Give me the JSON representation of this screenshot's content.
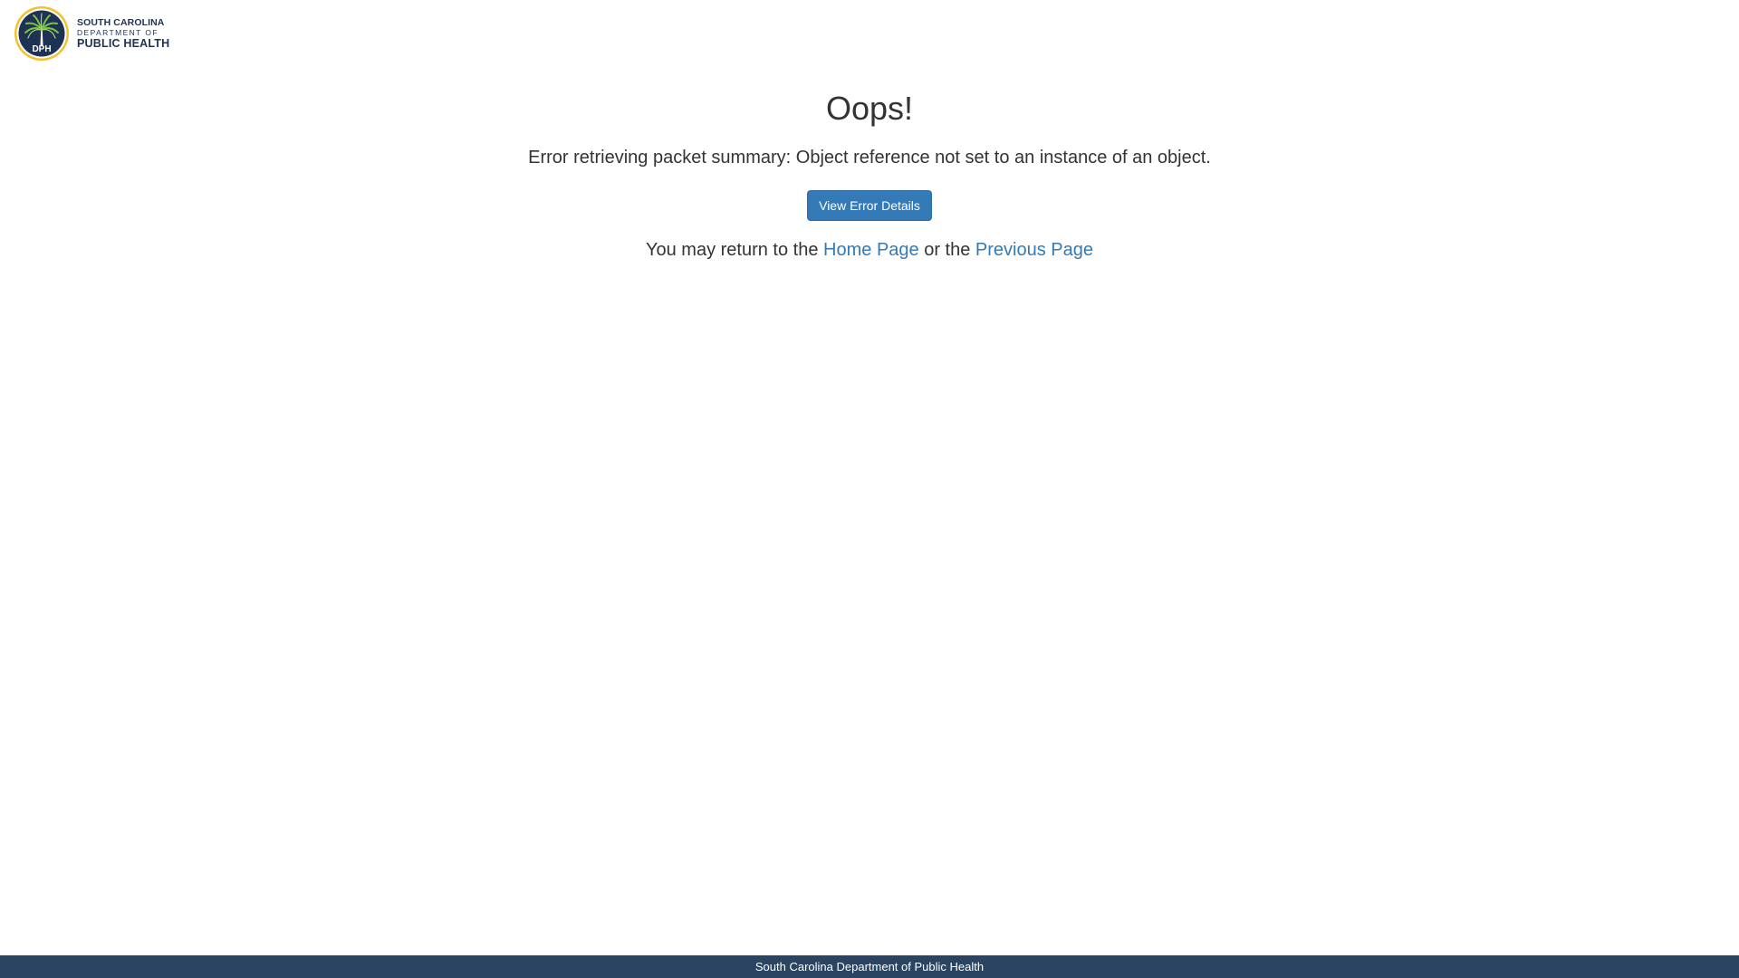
{
  "header": {
    "logo": {
      "seal_text": "DPH",
      "line1": "SOUTH CAROLINA",
      "line2": "DEPARTMENT OF",
      "line3": "PUBLIC HEALTH",
      "colors": {
        "navy": "#1e3354",
        "gold": "#f2c12e",
        "green": "#7cc242"
      }
    }
  },
  "main": {
    "title": "Oops!",
    "error_message": "Error retrieving packet summary: Object reference not set to an instance of an object.",
    "details_button_label": "View Error Details",
    "return_prefix": "You may return to the ",
    "home_link_label": "Home Page",
    "return_middle": " or the ",
    "previous_link_label": "Previous Page"
  },
  "footer": {
    "text": "South Carolina Department of Public Health"
  },
  "colors": {
    "link": "#337ab7",
    "button_bg": "#337ab7",
    "footer_bg": "#2b4462",
    "text": "#333333"
  }
}
